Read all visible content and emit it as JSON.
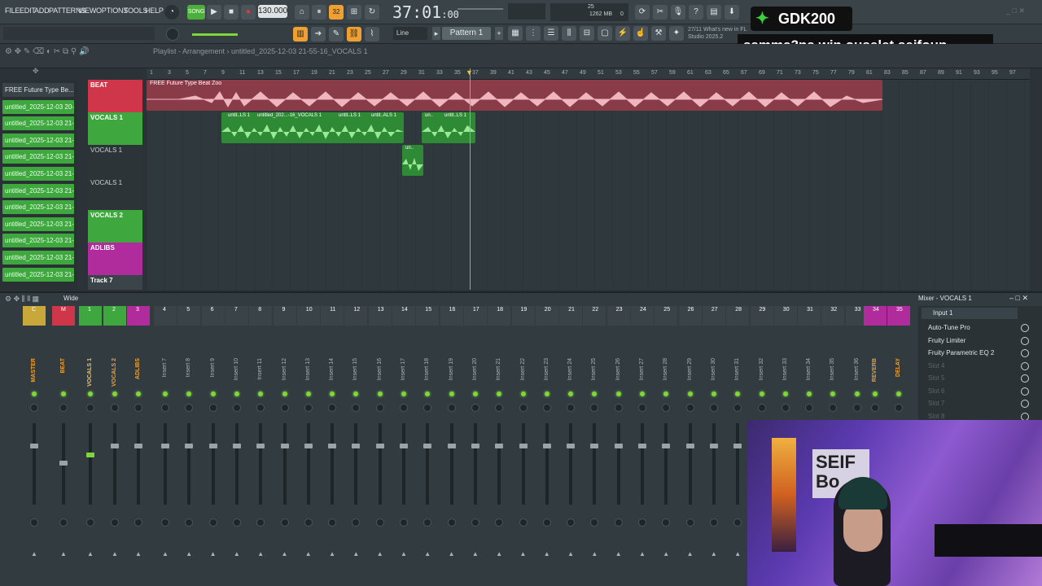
{
  "menu": [
    "FILE",
    "EDIT",
    "ADD",
    "PATTERNS",
    "VIEW",
    "OPTIONS",
    "TOOLS",
    "HELP"
  ],
  "transport": {
    "song_label": "SONG",
    "bpm": "130.000",
    "time": "37:01",
    "time_sub": ":00",
    "cpu": "25",
    "mem": "1262 MB",
    "mem_sub": "0"
  },
  "toolbar": {
    "pattern": "Pattern 1",
    "snap": "Line",
    "news_date": "27/11",
    "news_text": "What's new in FL",
    "news_text2": "Studio 2025.2"
  },
  "overlay": {
    "promo_code": "GDK200",
    "caption": "samma3na win ouselet seifoun"
  },
  "playlist": {
    "breadcrumb": "Playlist - Arrangement",
    "project": "untitled_2025-12-03 21-55-16_VOCALS 1",
    "timeline_ticks": [
      "1",
      "3",
      "5",
      "7",
      "9",
      "11",
      "13",
      "15",
      "17",
      "19",
      "21",
      "23",
      "25",
      "27",
      "29",
      "31",
      "33",
      "35",
      "37",
      "39",
      "41",
      "43",
      "45",
      "47",
      "49",
      "51",
      "53",
      "55",
      "57",
      "59",
      "61",
      "63",
      "65",
      "67",
      "69",
      "71",
      "73",
      "75",
      "77",
      "79",
      "81",
      "83",
      "85",
      "87",
      "89",
      "91",
      "93",
      "95",
      "97"
    ],
    "patterns": [
      "FREE Future Type Be...",
      "untitled_2025-12-03 20-",
      "untitled_2025-12-03 21-",
      "untitled_2025-12-03 21-",
      "untitled_2025-12-03 21-",
      "untitled_2025-12-03 21-",
      "untitled_2025-12-03 21-",
      "untitled_2025-12-03 21-",
      "untitled_2025-12-03 21-",
      "untitled_2025-12-03 21-",
      "untitled_2025-12-03 21-",
      "untitled_2025-12-03 21-"
    ],
    "tracks": [
      {
        "name": "BEAT",
        "color": "#d0364a"
      },
      {
        "name": "VOCALS 1",
        "color": "#3ea83e"
      },
      {
        "name": "VOCALS 1",
        "color": "#3ea83e"
      },
      {
        "name": "VOCALS 1",
        "color": "#3ea83e"
      },
      {
        "name": "VOCALS 2",
        "color": "#3ea83e"
      },
      {
        "name": "ADLIBS",
        "color": "#b02c9c"
      },
      {
        "name": "Track 7",
        "color": "#3b4448"
      }
    ],
    "clips": {
      "beat": "FREE Future Type Beat Zoo",
      "vocal_a": "untit..LS 1",
      "vocal_b": "untitled_202...-16_VOCALS 1",
      "vocal_c": "untit..LS 1",
      "vocal_d": "untit..ALS 1",
      "vocal_e": "un..",
      "vocal_f": "untit..LS 1",
      "vocal_g": "un.."
    }
  },
  "mixer": {
    "title": "Mixer - VOCALS 1",
    "mode": "Wide",
    "input": "Input 1",
    "channels": [
      "MASTER",
      "BEAT",
      "VOCALS 1",
      "VOCALS 2",
      "ADLIBS",
      "Insert 7",
      "Insert 8",
      "Insert 9",
      "Insert 10",
      "Insert 11",
      "Insert 12",
      "Insert 13",
      "Insert 14",
      "Insert 15",
      "Insert 16",
      "Insert 17",
      "Insert 18",
      "Insert 19",
      "Insert 20",
      "Insert 21",
      "Insert 22",
      "Insert 23",
      "Insert 24",
      "Insert 25",
      "Insert 26",
      "Insert 27",
      "Insert 28",
      "Insert 29",
      "Insert 30",
      "Insert 31",
      "Insert 32",
      "Insert 33",
      "Insert 34",
      "Insert 35",
      "Insert 36",
      "REVERB",
      "DELAY"
    ],
    "channel_numbers": [
      "C",
      "M",
      "1",
      "2",
      "3",
      "4",
      "5",
      "6",
      "7",
      "8",
      "9",
      "10",
      "11",
      "12",
      "13",
      "14",
      "15",
      "16",
      "17",
      "18",
      "19",
      "20",
      "21",
      "22",
      "23",
      "24",
      "25",
      "26",
      "27",
      "28",
      "29",
      "30",
      "31",
      "32",
      "33",
      "34",
      "35",
      "36"
    ],
    "fx_slots": [
      "Auto-Tune Pro",
      "Fruity Limiter",
      "Fruity Parametric EQ 2",
      "Slot 4",
      "Slot 5",
      "Slot 6",
      "Slot 7",
      "Slot 8"
    ]
  },
  "colors": {
    "accent": "#f0a030",
    "green": "#3ea83e",
    "beat": "#d0364a",
    "adlibs": "#b02c9c",
    "led": "#7fd63b"
  }
}
